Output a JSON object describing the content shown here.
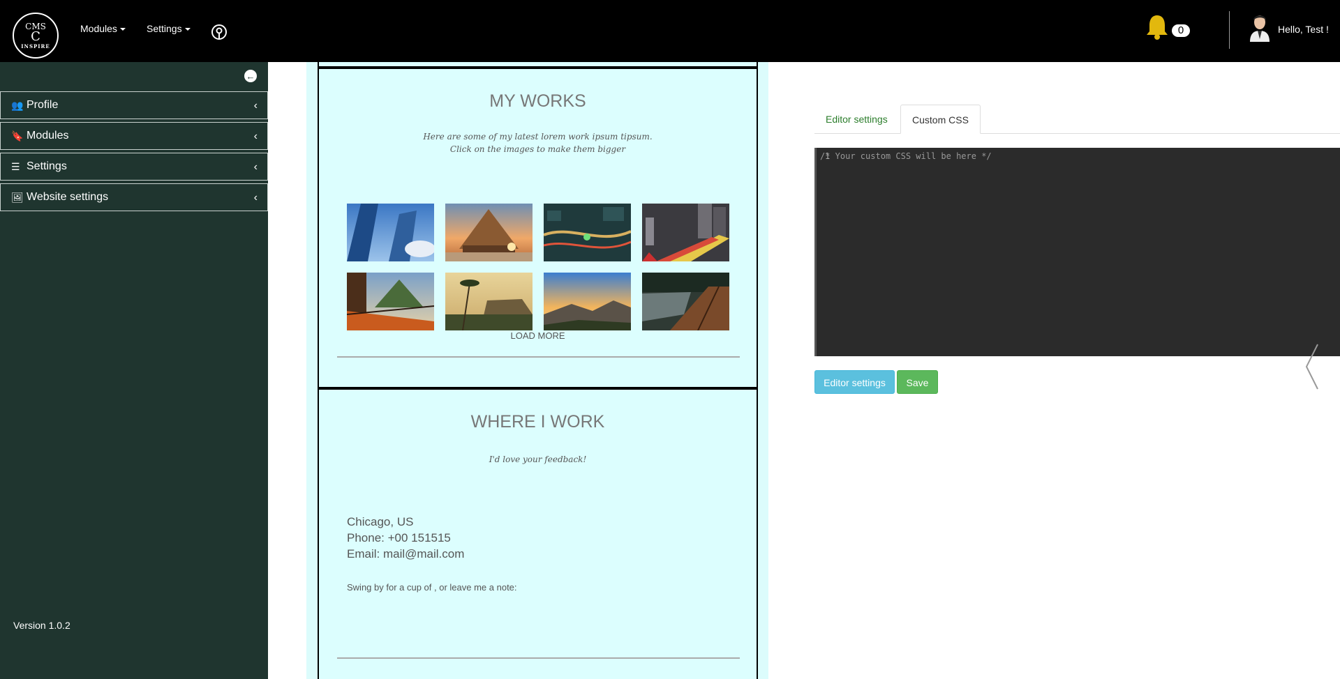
{
  "topbar": {
    "logo": {
      "line1": "CMS",
      "line2": "C",
      "line3": "INSPIRE"
    },
    "menu": [
      {
        "label": "Modules"
      },
      {
        "label": "Settings"
      }
    ],
    "notifications_count": "0",
    "greeting": "Hello, Test !"
  },
  "sidebar": {
    "items": [
      {
        "label": "Profile",
        "icon": "users-icon"
      },
      {
        "label": "Modules",
        "icon": "bookmark-icon"
      },
      {
        "label": "Settings",
        "icon": "list-icon"
      },
      {
        "label": "Website settings",
        "icon": "image-icon"
      }
    ],
    "version": "Version 1.0.2"
  },
  "preview": {
    "works": {
      "title": "MY WORKS",
      "subtitle_line1": "Here are some of my latest lorem work ipsum tipsum.",
      "subtitle_line2": "Click on the images to make them bigger",
      "load_more": "LOAD MORE",
      "images": [
        "skyscrapers-photo",
        "temple-sunset-photo",
        "city-highway-night-photo",
        "city-light-trails-photo",
        "terrace-mountain-photo",
        "palm-trees-cliff-photo",
        "mountain-sunrise-photo",
        "wooden-walkway-photo"
      ]
    },
    "where": {
      "title": "WHERE I WORK",
      "subtitle": "I'd love your feedback!",
      "city": "Chicago, US",
      "phone": "Phone: +00 151515",
      "email": "Email: mail@mail.com",
      "note": "Swing by for a cup of , or leave me a note:"
    }
  },
  "editor": {
    "tabs": [
      {
        "label": "Editor settings",
        "active": false
      },
      {
        "label": "Custom CSS",
        "active": true
      }
    ],
    "line_number": "1",
    "code_placeholder": "/* Your custom CSS will be here */",
    "buttons": {
      "editor_settings": "Editor settings",
      "save": "Save"
    }
  },
  "colors": {
    "topbar": "#000000",
    "sidebar": "#1f352f",
    "preview_bg": "#dcfefe",
    "info_button": "#5bc0de",
    "save_button": "#5cb85c",
    "bell": "#e2b80e"
  }
}
